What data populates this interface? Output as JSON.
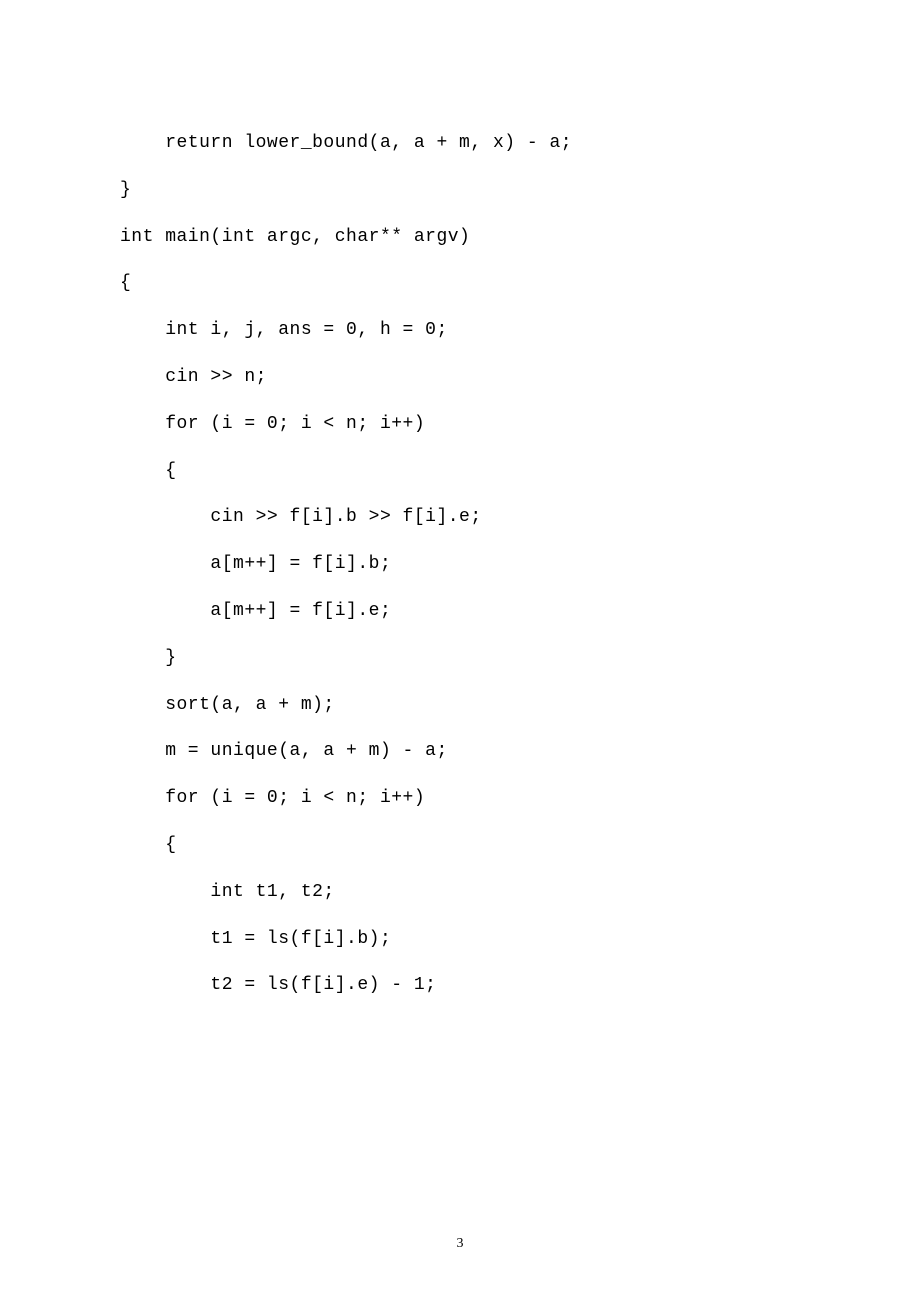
{
  "code": {
    "l0": "    return lower_bound(a, a + m, x) - a;",
    "l1": "}",
    "l2": "",
    "l3": "int main(int argc, char** argv)",
    "l4": "{",
    "l5": "    int i, j, ans = 0, h = 0;",
    "l6": "    cin >> n;",
    "l7": "    for (i = 0; i < n; i++)",
    "l8": "    {",
    "l9": "        cin >> f[i].b >> f[i].e;",
    "l10": "        a[m++] = f[i].b;",
    "l11": "",
    "l12": "        a[m++] = f[i].e;",
    "l13": "    }",
    "l14": "    sort(a, a + m);",
    "l15": "    m = unique(a, a + m) - a;",
    "l16": "    for (i = 0; i < n; i++)",
    "l17": "    {",
    "l18": "        int t1, t2;",
    "l19": "        t1 = ls(f[i].b);",
    "l20": "",
    "l21": "        t2 = ls(f[i].e) - 1;"
  },
  "page_number": "3"
}
